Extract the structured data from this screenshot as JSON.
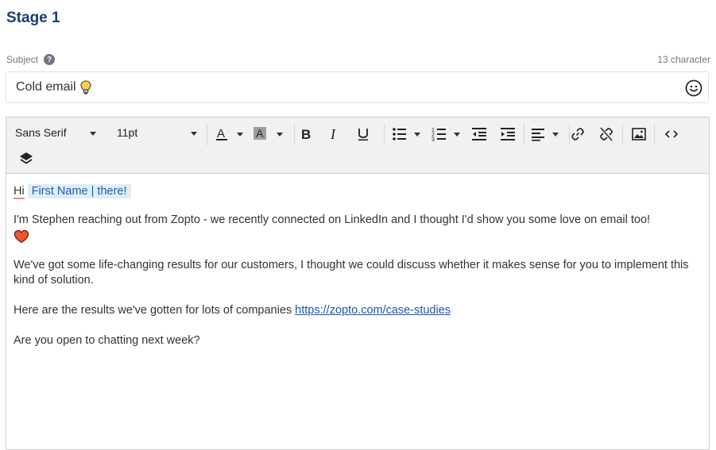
{
  "stage": {
    "title": "Stage 1"
  },
  "subject": {
    "label": "Subject",
    "help_icon": "question-circle-icon",
    "char_count": "13 character",
    "value": "Cold email",
    "value_icon": "light-bulb-emoji",
    "emoji_button_icon": "smiley-icon"
  },
  "toolbar": {
    "font_family": "Sans Serif",
    "font_size": "11pt",
    "items": [
      "font-color",
      "background-color",
      "bold",
      "italic",
      "underline",
      "bullet-list",
      "numbered-list",
      "outdent",
      "indent",
      "align",
      "link",
      "unlink",
      "image",
      "code-view",
      "layers"
    ]
  },
  "body": {
    "greeting_hi": "Hi",
    "merge_tag": "First Name | there!",
    "para1": "I'm Stephen reaching out from Zopto - we recently connected on LinkedIn and I thought I'd show you some love on email too!",
    "heart": "❤",
    "para2": "We've got some life-changing results for our customers, I thought we could discuss whether it makes sense for you to implement this kind of solution.",
    "para3_text": "Here are the results we've gotten for lots of companies ",
    "para3_link": "https://zopto.com/case-studies",
    "para4": "Are you open to chatting next week?"
  },
  "colors": {
    "title": "#1c3d6e",
    "link": "#1a56b0",
    "merge_tag_bg": "#ddeefb",
    "heart": "#f0562b"
  }
}
